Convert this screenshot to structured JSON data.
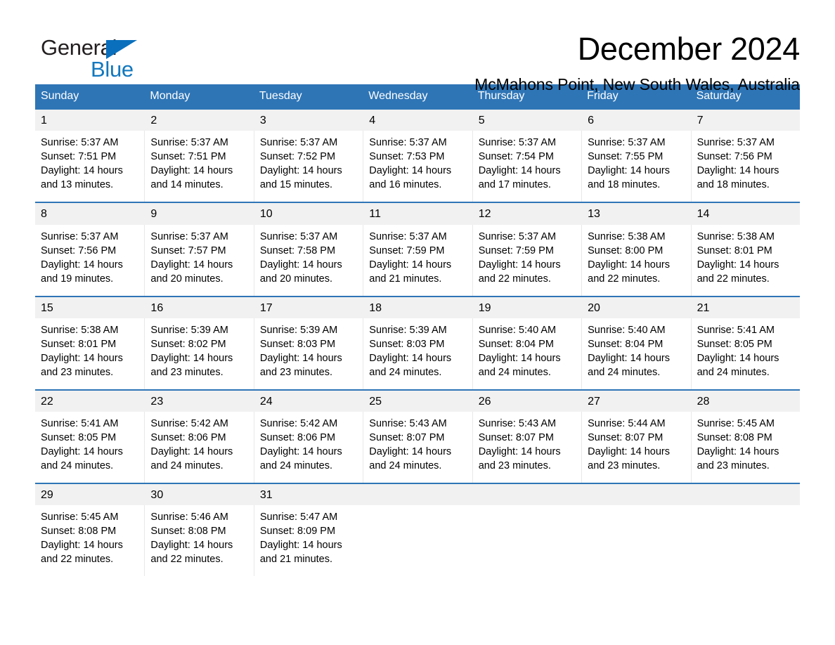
{
  "brand": {
    "name_part1": "General",
    "name_part2": "Blue",
    "triangle_color": "#0a70bd",
    "blue_text_color": "#1278be"
  },
  "header": {
    "month_title": "December 2024",
    "location": "McMahons Point, New South Wales, Australia"
  },
  "colors": {
    "header_blue": "#2e75b6",
    "daynum_background": "#f1f1f1",
    "page_background": "#ffffff"
  },
  "calendar": {
    "weekdays": [
      "Sunday",
      "Monday",
      "Tuesday",
      "Wednesday",
      "Thursday",
      "Friday",
      "Saturday"
    ],
    "weeks": [
      [
        {
          "day": "1",
          "sunrise": "Sunrise: 5:37 AM",
          "sunset": "Sunset: 7:51 PM",
          "daylight1": "Daylight: 14 hours",
          "daylight2": "and 13 minutes."
        },
        {
          "day": "2",
          "sunrise": "Sunrise: 5:37 AM",
          "sunset": "Sunset: 7:51 PM",
          "daylight1": "Daylight: 14 hours",
          "daylight2": "and 14 minutes."
        },
        {
          "day": "3",
          "sunrise": "Sunrise: 5:37 AM",
          "sunset": "Sunset: 7:52 PM",
          "daylight1": "Daylight: 14 hours",
          "daylight2": "and 15 minutes."
        },
        {
          "day": "4",
          "sunrise": "Sunrise: 5:37 AM",
          "sunset": "Sunset: 7:53 PM",
          "daylight1": "Daylight: 14 hours",
          "daylight2": "and 16 minutes."
        },
        {
          "day": "5",
          "sunrise": "Sunrise: 5:37 AM",
          "sunset": "Sunset: 7:54 PM",
          "daylight1": "Daylight: 14 hours",
          "daylight2": "and 17 minutes."
        },
        {
          "day": "6",
          "sunrise": "Sunrise: 5:37 AM",
          "sunset": "Sunset: 7:55 PM",
          "daylight1": "Daylight: 14 hours",
          "daylight2": "and 18 minutes."
        },
        {
          "day": "7",
          "sunrise": "Sunrise: 5:37 AM",
          "sunset": "Sunset: 7:56 PM",
          "daylight1": "Daylight: 14 hours",
          "daylight2": "and 18 minutes."
        }
      ],
      [
        {
          "day": "8",
          "sunrise": "Sunrise: 5:37 AM",
          "sunset": "Sunset: 7:56 PM",
          "daylight1": "Daylight: 14 hours",
          "daylight2": "and 19 minutes."
        },
        {
          "day": "9",
          "sunrise": "Sunrise: 5:37 AM",
          "sunset": "Sunset: 7:57 PM",
          "daylight1": "Daylight: 14 hours",
          "daylight2": "and 20 minutes."
        },
        {
          "day": "10",
          "sunrise": "Sunrise: 5:37 AM",
          "sunset": "Sunset: 7:58 PM",
          "daylight1": "Daylight: 14 hours",
          "daylight2": "and 20 minutes."
        },
        {
          "day": "11",
          "sunrise": "Sunrise: 5:37 AM",
          "sunset": "Sunset: 7:59 PM",
          "daylight1": "Daylight: 14 hours",
          "daylight2": "and 21 minutes."
        },
        {
          "day": "12",
          "sunrise": "Sunrise: 5:37 AM",
          "sunset": "Sunset: 7:59 PM",
          "daylight1": "Daylight: 14 hours",
          "daylight2": "and 22 minutes."
        },
        {
          "day": "13",
          "sunrise": "Sunrise: 5:38 AM",
          "sunset": "Sunset: 8:00 PM",
          "daylight1": "Daylight: 14 hours",
          "daylight2": "and 22 minutes."
        },
        {
          "day": "14",
          "sunrise": "Sunrise: 5:38 AM",
          "sunset": "Sunset: 8:01 PM",
          "daylight1": "Daylight: 14 hours",
          "daylight2": "and 22 minutes."
        }
      ],
      [
        {
          "day": "15",
          "sunrise": "Sunrise: 5:38 AM",
          "sunset": "Sunset: 8:01 PM",
          "daylight1": "Daylight: 14 hours",
          "daylight2": "and 23 minutes."
        },
        {
          "day": "16",
          "sunrise": "Sunrise: 5:39 AM",
          "sunset": "Sunset: 8:02 PM",
          "daylight1": "Daylight: 14 hours",
          "daylight2": "and 23 minutes."
        },
        {
          "day": "17",
          "sunrise": "Sunrise: 5:39 AM",
          "sunset": "Sunset: 8:03 PM",
          "daylight1": "Daylight: 14 hours",
          "daylight2": "and 23 minutes."
        },
        {
          "day": "18",
          "sunrise": "Sunrise: 5:39 AM",
          "sunset": "Sunset: 8:03 PM",
          "daylight1": "Daylight: 14 hours",
          "daylight2": "and 24 minutes."
        },
        {
          "day": "19",
          "sunrise": "Sunrise: 5:40 AM",
          "sunset": "Sunset: 8:04 PM",
          "daylight1": "Daylight: 14 hours",
          "daylight2": "and 24 minutes."
        },
        {
          "day": "20",
          "sunrise": "Sunrise: 5:40 AM",
          "sunset": "Sunset: 8:04 PM",
          "daylight1": "Daylight: 14 hours",
          "daylight2": "and 24 minutes."
        },
        {
          "day": "21",
          "sunrise": "Sunrise: 5:41 AM",
          "sunset": "Sunset: 8:05 PM",
          "daylight1": "Daylight: 14 hours",
          "daylight2": "and 24 minutes."
        }
      ],
      [
        {
          "day": "22",
          "sunrise": "Sunrise: 5:41 AM",
          "sunset": "Sunset: 8:05 PM",
          "daylight1": "Daylight: 14 hours",
          "daylight2": "and 24 minutes."
        },
        {
          "day": "23",
          "sunrise": "Sunrise: 5:42 AM",
          "sunset": "Sunset: 8:06 PM",
          "daylight1": "Daylight: 14 hours",
          "daylight2": "and 24 minutes."
        },
        {
          "day": "24",
          "sunrise": "Sunrise: 5:42 AM",
          "sunset": "Sunset: 8:06 PM",
          "daylight1": "Daylight: 14 hours",
          "daylight2": "and 24 minutes."
        },
        {
          "day": "25",
          "sunrise": "Sunrise: 5:43 AM",
          "sunset": "Sunset: 8:07 PM",
          "daylight1": "Daylight: 14 hours",
          "daylight2": "and 24 minutes."
        },
        {
          "day": "26",
          "sunrise": "Sunrise: 5:43 AM",
          "sunset": "Sunset: 8:07 PM",
          "daylight1": "Daylight: 14 hours",
          "daylight2": "and 23 minutes."
        },
        {
          "day": "27",
          "sunrise": "Sunrise: 5:44 AM",
          "sunset": "Sunset: 8:07 PM",
          "daylight1": "Daylight: 14 hours",
          "daylight2": "and 23 minutes."
        },
        {
          "day": "28",
          "sunrise": "Sunrise: 5:45 AM",
          "sunset": "Sunset: 8:08 PM",
          "daylight1": "Daylight: 14 hours",
          "daylight2": "and 23 minutes."
        }
      ],
      [
        {
          "day": "29",
          "sunrise": "Sunrise: 5:45 AM",
          "sunset": "Sunset: 8:08 PM",
          "daylight1": "Daylight: 14 hours",
          "daylight2": "and 22 minutes."
        },
        {
          "day": "30",
          "sunrise": "Sunrise: 5:46 AM",
          "sunset": "Sunset: 8:08 PM",
          "daylight1": "Daylight: 14 hours",
          "daylight2": "and 22 minutes."
        },
        {
          "day": "31",
          "sunrise": "Sunrise: 5:47 AM",
          "sunset": "Sunset: 8:09 PM",
          "daylight1": "Daylight: 14 hours",
          "daylight2": "and 21 minutes."
        },
        {
          "day": "",
          "sunrise": "",
          "sunset": "",
          "daylight1": "",
          "daylight2": ""
        },
        {
          "day": "",
          "sunrise": "",
          "sunset": "",
          "daylight1": "",
          "daylight2": ""
        },
        {
          "day": "",
          "sunrise": "",
          "sunset": "",
          "daylight1": "",
          "daylight2": ""
        },
        {
          "day": "",
          "sunrise": "",
          "sunset": "",
          "daylight1": "",
          "daylight2": ""
        }
      ]
    ]
  }
}
